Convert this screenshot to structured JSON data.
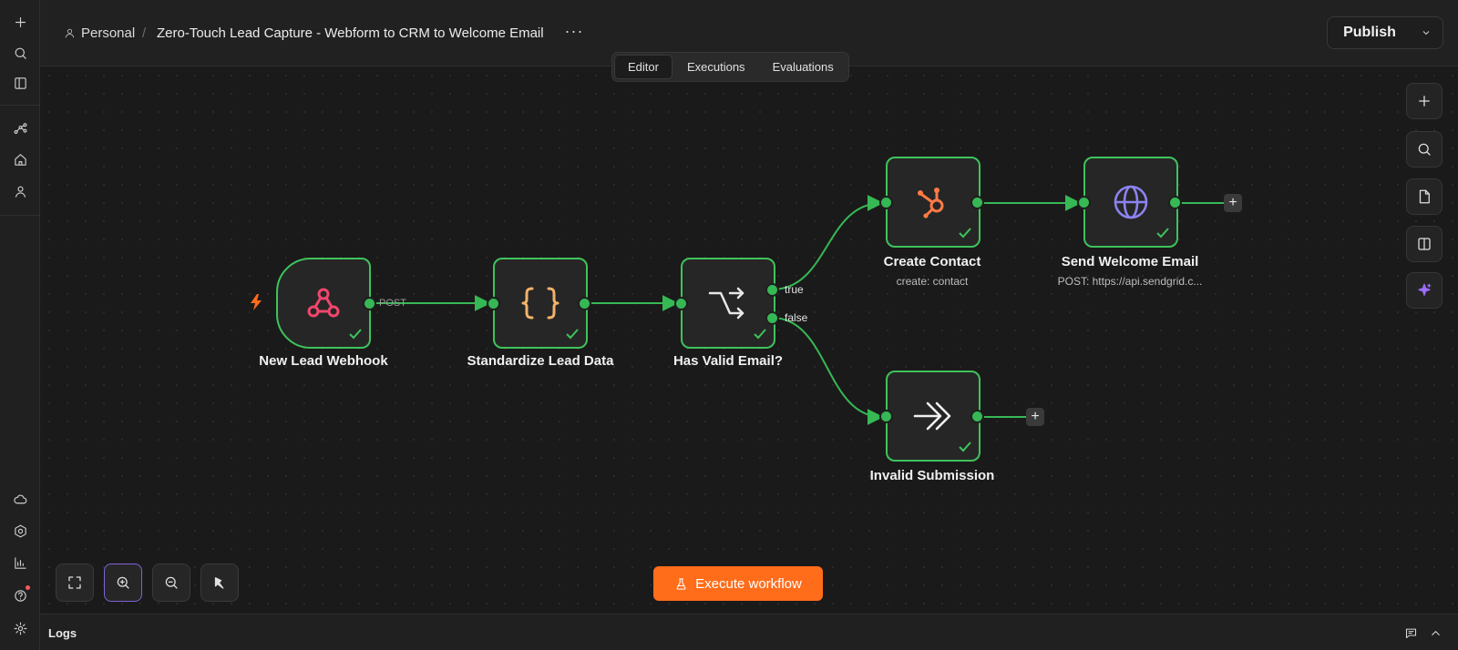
{
  "header": {
    "personal": "Personal",
    "separator": "/",
    "workflow_title": "Zero-Touch Lead Capture - Webform to CRM to Welcome Email",
    "more": "···",
    "publish": "Publish"
  },
  "tabs": [
    "Editor",
    "Executions",
    "Evaluations"
  ],
  "active_tab": "Editor",
  "nodes": [
    {
      "label": "New Lead Webhook",
      "icon": "webhook-icon",
      "status": "success"
    },
    {
      "label": "Standardize Lead Data",
      "icon": "braces-icon",
      "status": "success"
    },
    {
      "label": "Has Valid Email?",
      "icon": "branch-icon",
      "status": "success"
    },
    {
      "label": "Create Contact",
      "subtitle": "create: contact",
      "icon": "hubspot-icon",
      "status": "success"
    },
    {
      "label": "Send Welcome Email",
      "subtitle": "POST: https://api.sendgrid.c...",
      "icon": "globe-icon",
      "status": "success"
    },
    {
      "label": "Invalid Submission",
      "icon": "no-op-icon",
      "status": "success"
    }
  ],
  "edge_labels": {
    "webhook_method": "POST",
    "if_true": "true",
    "if_false": "false"
  },
  "add_node": "+",
  "execute_button": "Execute workflow",
  "logs": "Logs",
  "colors": {
    "node_success_border": "#3ec35c",
    "execute_button": "#ff6d1b",
    "hubspot": "#ff7a45",
    "webhook": "#f0466d",
    "braces": "#f2b36b",
    "globe": "#8b83f0",
    "ai_sparkle": "#9b6cff"
  }
}
